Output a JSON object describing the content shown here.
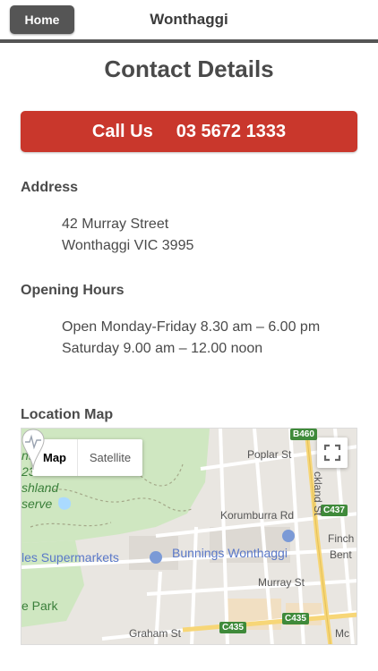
{
  "header": {
    "home_label": "Home",
    "site_title": "Wonthaggi"
  },
  "page_title": "Contact Details",
  "call": {
    "label": "Call Us",
    "phone": "03 5672 1333",
    "color": "#c9372c"
  },
  "address": {
    "heading": "Address",
    "line1": "42 Murray Street",
    "line2": "Wonthaggi VIC 3995"
  },
  "hours": {
    "heading": "Opening Hours",
    "line1": "Open Monday-Friday 8.30 am – 6.00 pm",
    "line2": "Saturday 9.00 am – 12.00 noon"
  },
  "map": {
    "heading": "Location Map",
    "type_map": "Map",
    "type_satellite": "Satellite",
    "labels": {
      "poplar": "Poplar St",
      "korumburra": "Korumburra Rd",
      "murray": "Murray St",
      "graham": "Graham St",
      "bunnings": "Bunnings Wonthaggi",
      "supermarkets": "les Supermarkets",
      "park": "e Park",
      "finch": "Finch",
      "bent": "Bent",
      "inland_st": "ckland St",
      "mc": "Mc",
      "left1": "nthl",
      "left2": "238",
      "left3": "shland",
      "left4": "serve"
    },
    "shields": {
      "b460": "B460",
      "c437": "C437",
      "c435a": "C435",
      "c435b": "C435"
    }
  }
}
